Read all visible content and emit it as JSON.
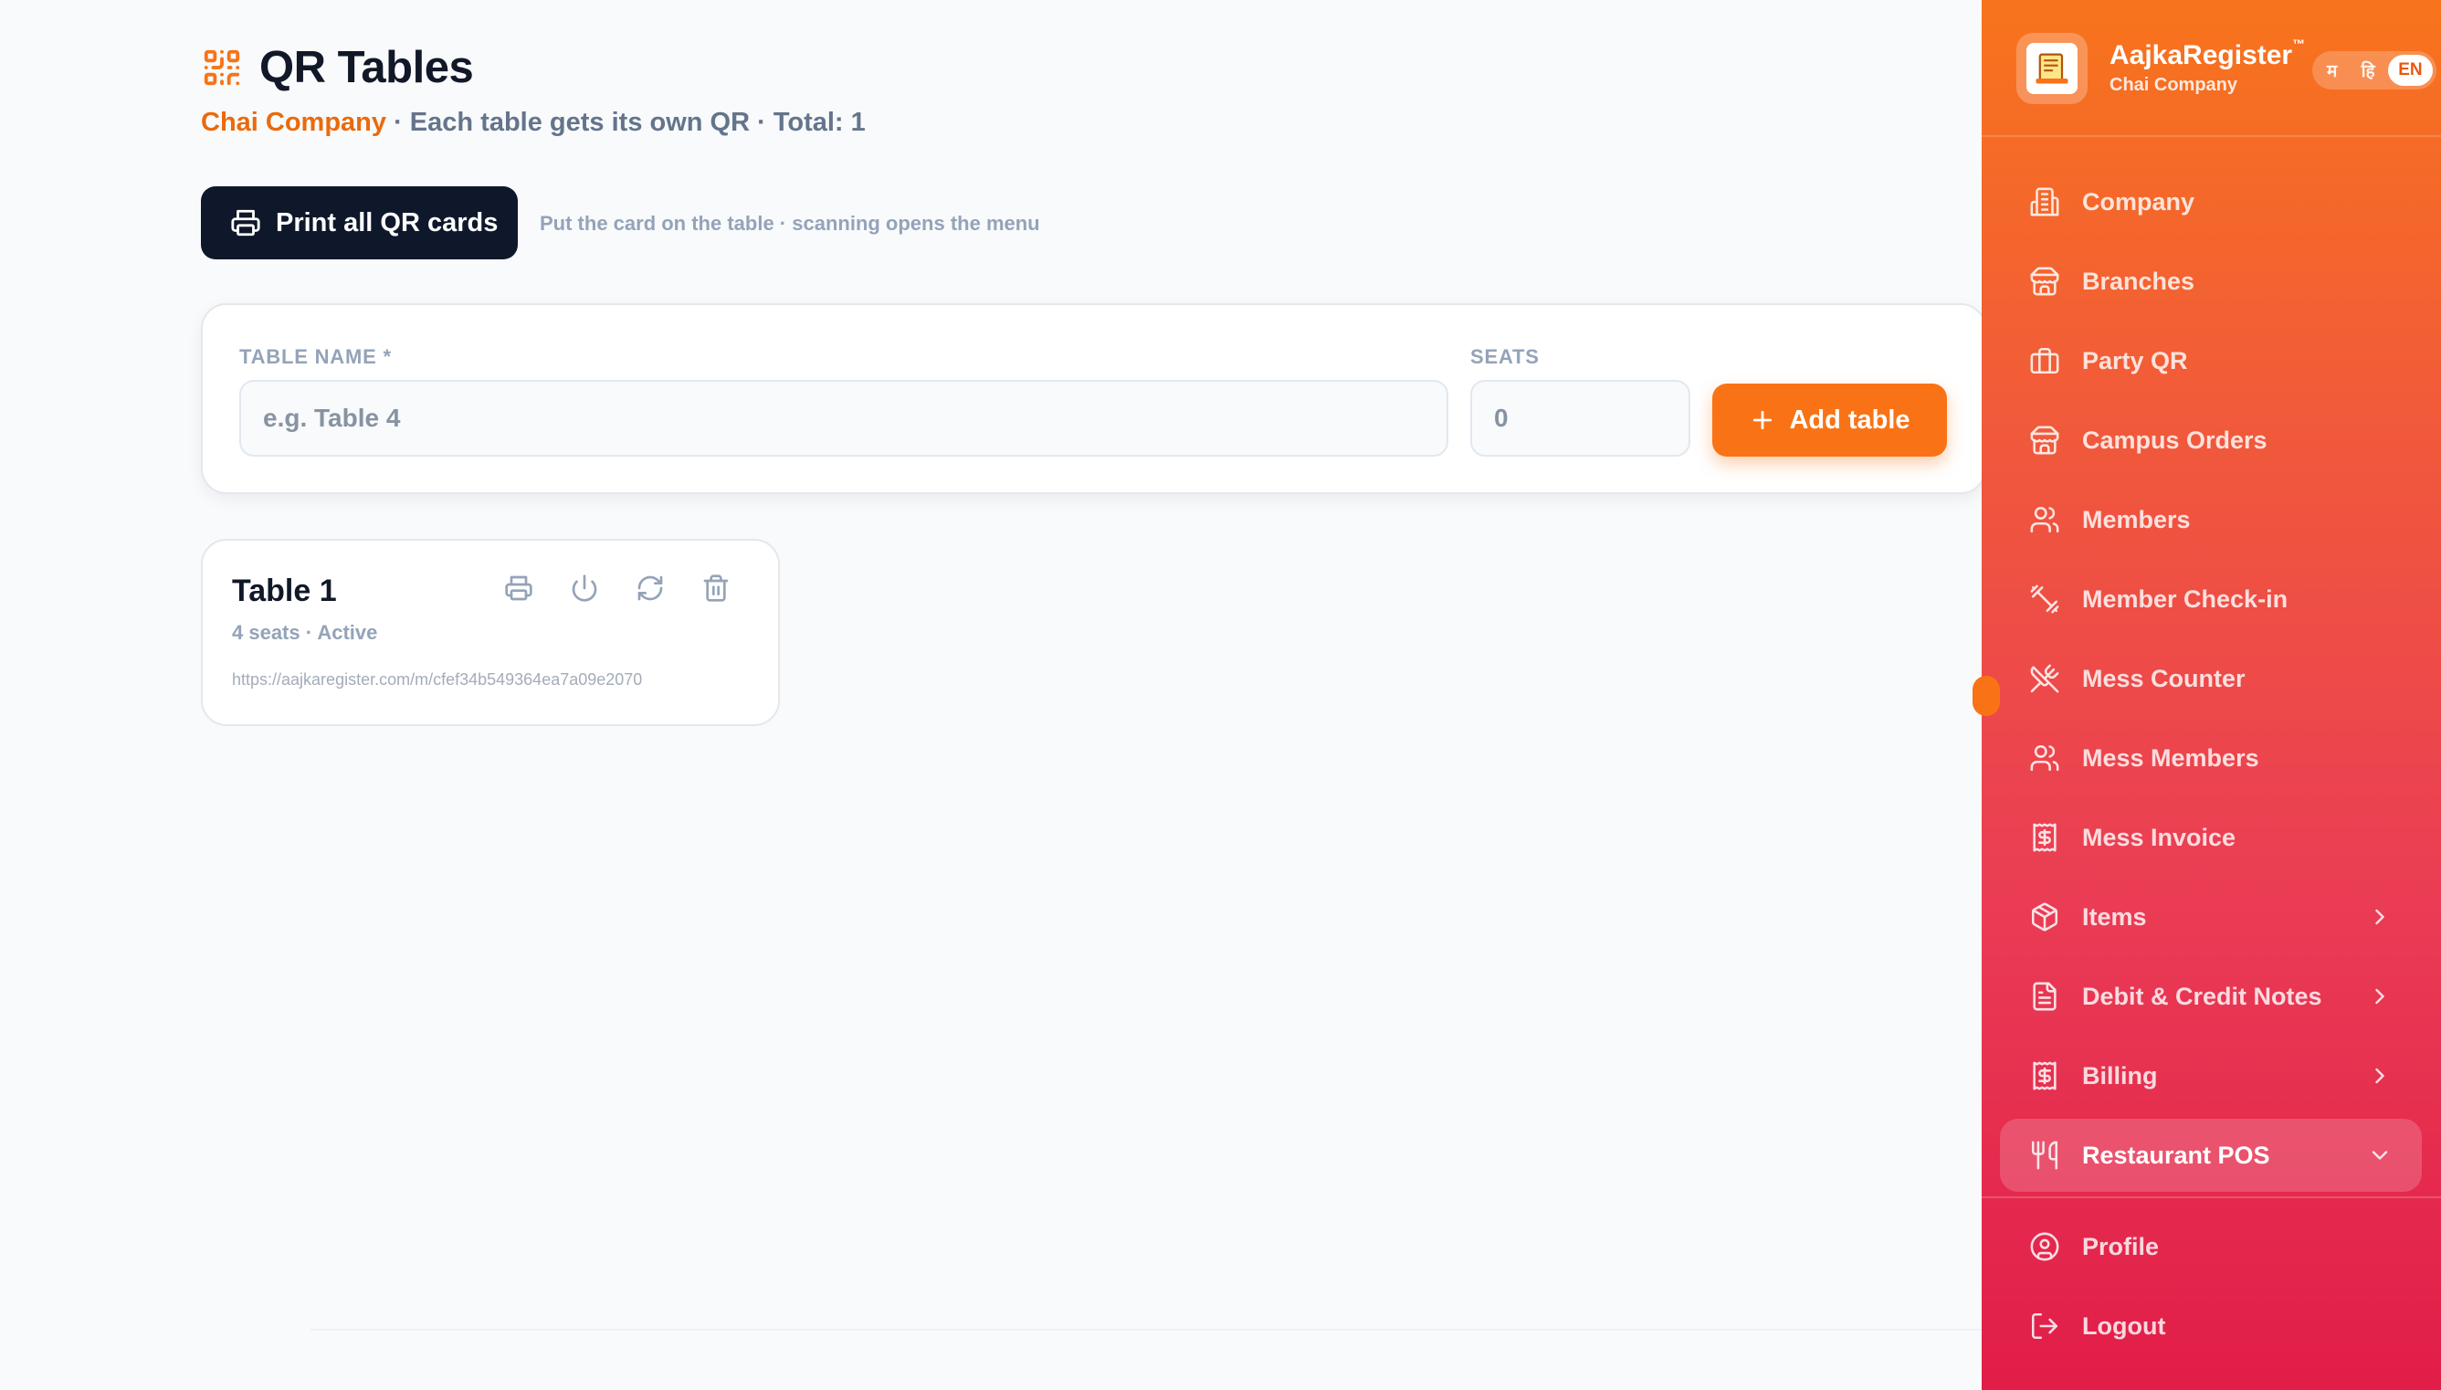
{
  "page": {
    "title": "QR Tables",
    "subtitle_company": "Chai Company",
    "subtitle_rest": " · Each table gets its own QR · Total: 1"
  },
  "actions": {
    "print_all_label": "Print all QR cards",
    "print_hint": "Put the card on the table · scanning opens the menu"
  },
  "form": {
    "table_name_label": "TABLE NAME *",
    "table_name_placeholder": "e.g. Table 4",
    "table_name_value": "",
    "seats_label": "SEATS",
    "seats_placeholder": "0",
    "seats_value": "",
    "add_label": "Add table"
  },
  "tables": [
    {
      "name": "Table 1",
      "meta": "4 seats · Active",
      "url": "https://aajkaregister.com/m/cfef34b549364ea7a09e2070"
    }
  ],
  "sidebar": {
    "brand": "AajkaRegister",
    "brand_tm": "™",
    "company": "Chai Company",
    "languages": [
      "म",
      "हि",
      "EN"
    ],
    "active_language": "EN",
    "items": [
      {
        "label": "Company",
        "icon": "building-icon"
      },
      {
        "label": "Branches",
        "icon": "store-icon"
      },
      {
        "label": "Party QR",
        "icon": "briefcase-icon"
      },
      {
        "label": "Campus Orders",
        "icon": "store-icon"
      },
      {
        "label": "Members",
        "icon": "users-icon"
      },
      {
        "label": "Member Check-in",
        "icon": "dumbbell-icon"
      },
      {
        "label": "Mess Counter",
        "icon": "utensils-crossed-icon"
      },
      {
        "label": "Mess Members",
        "icon": "users-icon"
      },
      {
        "label": "Mess Invoice",
        "icon": "receipt-icon"
      },
      {
        "label": "Items",
        "icon": "package-icon",
        "chevron": "right"
      },
      {
        "label": "Debit & Credit Notes",
        "icon": "file-icon",
        "chevron": "right"
      },
      {
        "label": "Billing",
        "icon": "receipt-icon",
        "chevron": "right"
      },
      {
        "label": "Restaurant POS",
        "icon": "utensils-icon",
        "chevron": "down",
        "active": true
      }
    ],
    "footer_items": [
      {
        "label": "Profile",
        "icon": "user-circle-icon"
      },
      {
        "label": "Logout",
        "icon": "logout-icon"
      }
    ]
  },
  "colors": {
    "accent": "#f97316",
    "dark_button": "#0f172a",
    "sidebar_top": "#f8741c",
    "sidebar_bottom": "#e11d48"
  }
}
